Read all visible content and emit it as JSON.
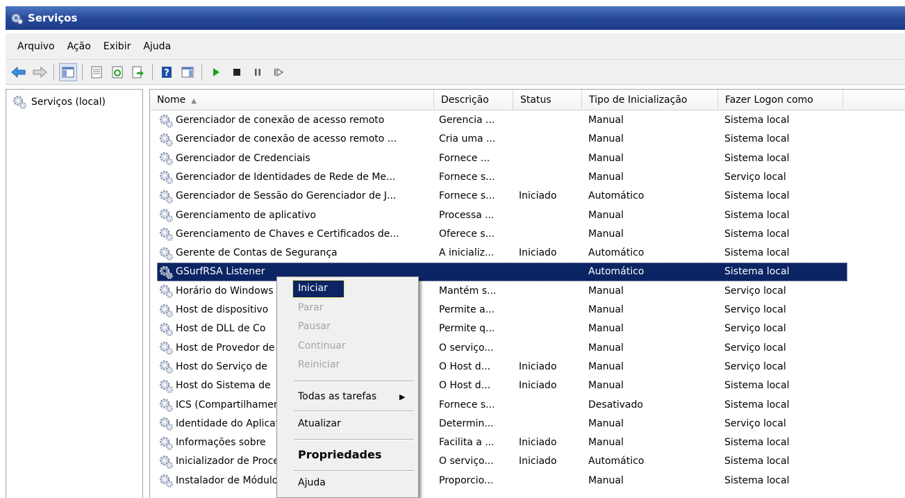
{
  "window": {
    "title": "Serviços"
  },
  "menu": [
    "Arquivo",
    "Ação",
    "Exibir",
    "Ajuda"
  ],
  "toolbar": {
    "buttons": [
      "back-icon",
      "forward-icon",
      "show-hide-tree-icon",
      "properties-icon",
      "refresh-icon",
      "export-list-icon",
      "help-icon",
      "show-action-pane-icon",
      "play-icon",
      "stop-icon",
      "pause-icon",
      "resume-icon"
    ],
    "colors": {
      "play": "#1aa31a",
      "stop": "#222222",
      "help": "#1e4fa8"
    }
  },
  "tree": {
    "root_label": "Serviços (local)"
  },
  "table": {
    "headers": {
      "name": "Nome",
      "desc": "Descrição",
      "status": "Status",
      "tipo": "Tipo de Inicialização",
      "logon": "Fazer Logon como"
    },
    "rows": [
      {
        "name": "Gerenciador de conexão de acesso remoto",
        "desc": "Gerencia ...",
        "status": "",
        "tipo": "Manual",
        "logon": "Sistema local"
      },
      {
        "name": "Gerenciador de conexão de acesso remoto ...",
        "desc": "Cria uma ...",
        "status": "",
        "tipo": "Manual",
        "logon": "Sistema local"
      },
      {
        "name": "Gerenciador de Credenciais",
        "desc": "Fornece ...",
        "status": "",
        "tipo": "Manual",
        "logon": "Sistema local"
      },
      {
        "name": "Gerenciador de Identidades de Rede de Me...",
        "desc": "Fornece s...",
        "status": "",
        "tipo": "Manual",
        "logon": "Serviço local"
      },
      {
        "name": "Gerenciador de Sessão do Gerenciador de J...",
        "desc": "Fornece s...",
        "status": "Iniciado",
        "tipo": "Automático",
        "logon": "Sistema local"
      },
      {
        "name": "Gerenciamento de aplicativo",
        "desc": "Processa ...",
        "status": "",
        "tipo": "Manual",
        "logon": "Sistema local"
      },
      {
        "name": "Gerenciamento de Chaves e Certificados de...",
        "desc": "Oferece s...",
        "status": "",
        "tipo": "Manual",
        "logon": "Sistema local"
      },
      {
        "name": "Gerente de Contas de Segurança",
        "desc": "A inicializ...",
        "status": "Iniciado",
        "tipo": "Automático",
        "logon": "Sistema local"
      },
      {
        "name": "GSurfRSA Listener",
        "desc": "",
        "status": "",
        "tipo": "Automático",
        "logon": "Sistema local",
        "selected": true
      },
      {
        "name": "Horário do Windows",
        "desc": "Mantém s...",
        "status": "",
        "tipo": "Manual",
        "logon": "Serviço local"
      },
      {
        "name": "Host de dispositivo",
        "desc": "Permite a...",
        "status": "",
        "tipo": "Manual",
        "logon": "Serviço local"
      },
      {
        "name": "Host de DLL de Co",
        "desc": "Permite q...",
        "status": "",
        "tipo": "Manual",
        "logon": "Serviço local"
      },
      {
        "name": "Host de Provedor de",
        "desc": "O serviço...",
        "status": "",
        "tipo": "Manual",
        "logon": "Serviço local"
      },
      {
        "name": "Host do Serviço de",
        "desc": "O Host d...",
        "status": "Iniciado",
        "tipo": "Manual",
        "logon": "Serviço local"
      },
      {
        "name": "Host do Sistema de",
        "desc": "O Host d...",
        "status": "Iniciado",
        "tipo": "Manual",
        "logon": "Sistema local"
      },
      {
        "name": "ICS (Compartilhamento",
        "desc": "Fornece s...",
        "status": "",
        "tipo": "Desativado",
        "logon": "Sistema local"
      },
      {
        "name": "Identidade do Aplicativo",
        "desc": "Determin...",
        "status": "",
        "tipo": "Manual",
        "logon": "Serviço local"
      },
      {
        "name": "Informações sobre",
        "desc": "Facilita a ...",
        "status": "Iniciado",
        "tipo": "Manual",
        "logon": "Sistema local"
      },
      {
        "name": "Inicializador de Processos",
        "desc": "O serviço...",
        "status": "Iniciado",
        "tipo": "Automático",
        "logon": "Sistema local"
      },
      {
        "name": "Instalador de Módulos",
        "desc": "Proporcio...",
        "status": "",
        "tipo": "Manual",
        "logon": "Sistema local"
      }
    ]
  },
  "context_menu": {
    "iniciar": "Iniciar",
    "parar": "Parar",
    "pausar": "Pausar",
    "continuar": "Continuar",
    "reiniciar": "Reiniciar",
    "todas_tarefas": "Todas as tarefas",
    "submenu_arrow": "▶",
    "atualizar": "Atualizar",
    "propriedades": "Propriedades",
    "ajuda": "Ajuda"
  }
}
